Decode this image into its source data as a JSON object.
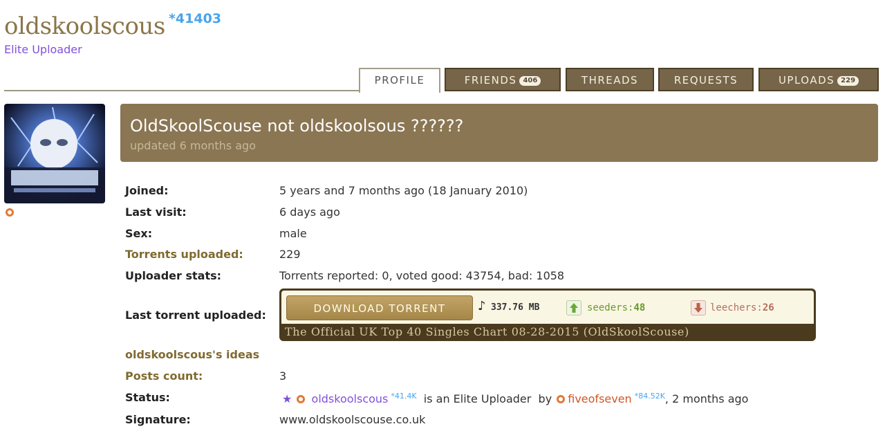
{
  "user": {
    "username": "oldskoolscous",
    "reputation": "*41403",
    "rank": "Elite Uploader"
  },
  "tabs": {
    "profile": "PROFILE",
    "friends": "FRIENDS",
    "friends_count": "406",
    "threads": "THREADS",
    "requests": "REQUESTS",
    "uploads": "UPLOADS",
    "uploads_count": "229"
  },
  "header": {
    "title": "OldSkoolScouse not oldskoolsous ??????",
    "updated": "updated 6 months ago"
  },
  "profile": {
    "joined_label": "Joined:",
    "joined_value": "5 years and 7 months ago (18 January 2010)",
    "last_visit_label": "Last visit:",
    "last_visit_value": "6 days ago",
    "sex_label": "Sex:",
    "sex_value": "male",
    "torrents_label": "Torrents uploaded:",
    "torrents_value": "229",
    "uploader_stats_label": "Uploader stats:",
    "uploader_stats_value": "Torrents reported: 0, voted good: 43754, bad: 1058",
    "last_torrent_label": "Last torrent uploaded:",
    "ideas_label": "oldskoolscous's ideas",
    "posts_label": "Posts count:",
    "posts_value": "3",
    "status_label": "Status:",
    "signature_label": "Signature:",
    "signature_value": "www.oldskoolscouse.co.uk"
  },
  "torrent": {
    "download_label": "DOWNLOAD TORRENT",
    "size": "337.76 MB",
    "seeders_label": "seeders:",
    "seeders_value": "48",
    "leechers_label": "leechers:",
    "leechers_value": "26",
    "name": "The Official UK Top 40 Singles Chart 08-28-2015 (OldSkoolScouse)"
  },
  "status": {
    "user": "oldskoolscous",
    "user_rep": "*41.4K",
    "text": "is an Elite Uploader",
    "by": "by",
    "by_user": "fiveofseven",
    "by_rep": "*84.52K",
    "time": ", 2 months ago"
  },
  "colors": {
    "accent_brown": "#8a7653",
    "rank_purple": "#8250df",
    "rep_blue": "#4aa3ec",
    "online_orange": "#e07a3a"
  }
}
